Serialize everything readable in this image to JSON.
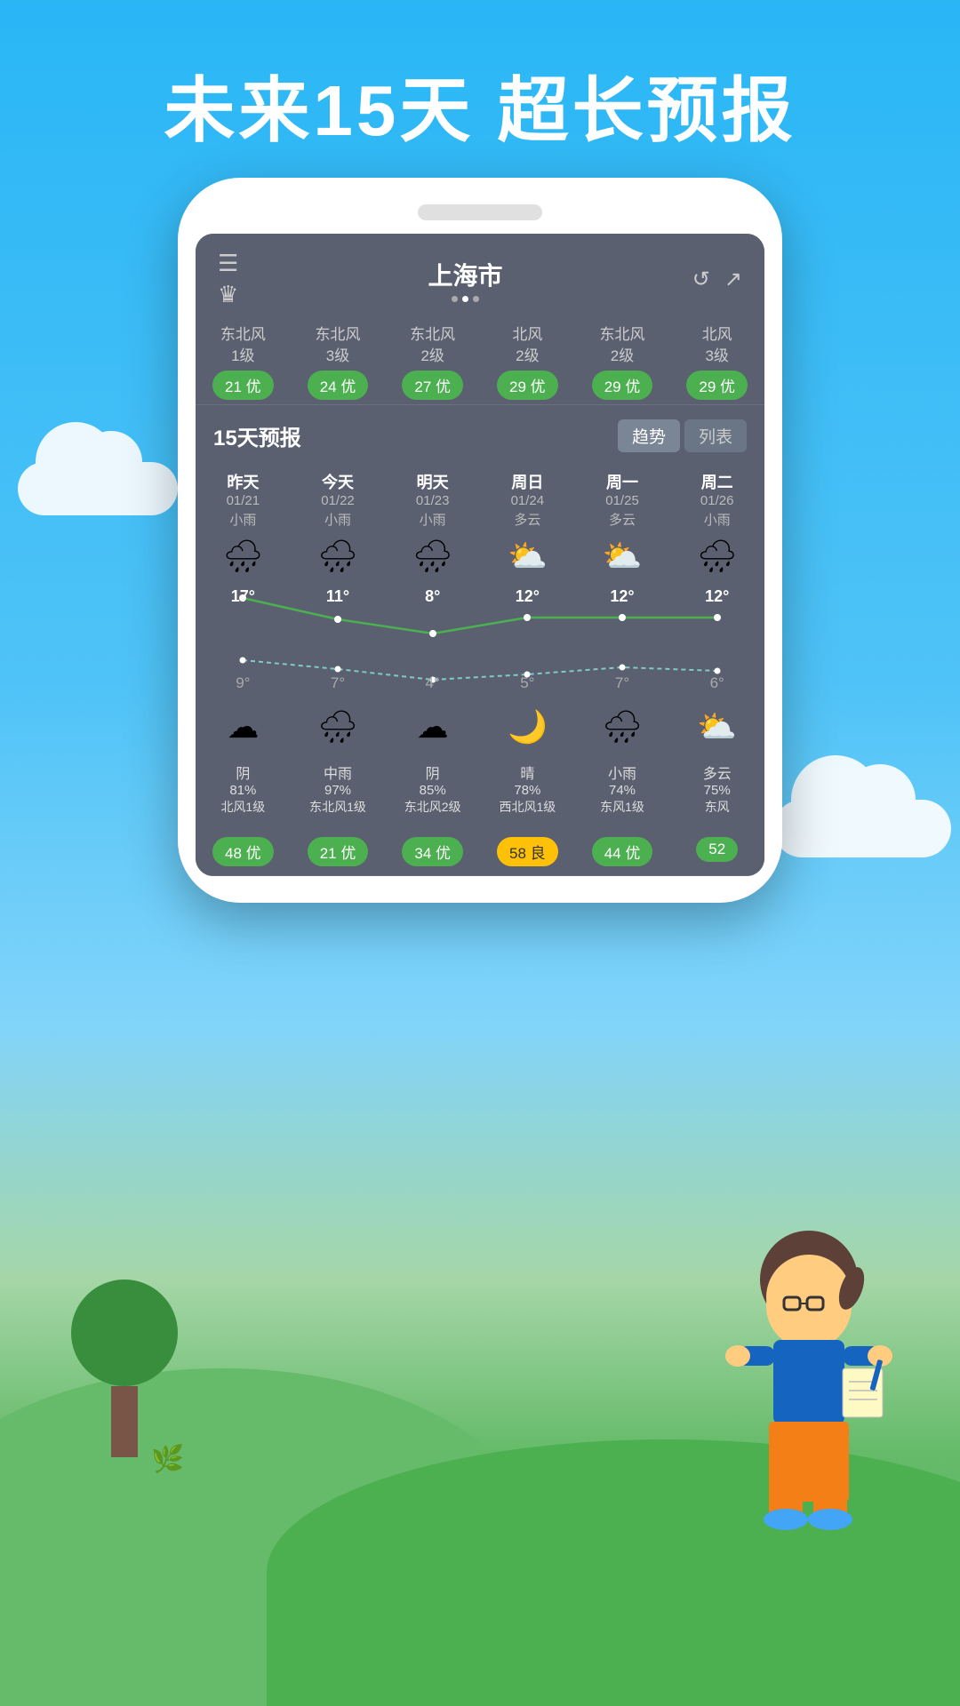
{
  "header": {
    "title": "未来15天  超长预报"
  },
  "app": {
    "city": "上海市",
    "menu_icon": "☰",
    "crown_icon": "♛",
    "refresh_icon": "↺",
    "share_icon": "↗",
    "dots": [
      false,
      true,
      false
    ]
  },
  "wind_row": [
    {
      "wind": "东北风\n1级",
      "aqi": "21 优",
      "type": "good"
    },
    {
      "wind": "东北风\n3级",
      "aqi": "24 优",
      "type": "good"
    },
    {
      "wind": "东北风\n2级",
      "aqi": "27 优",
      "type": "good"
    },
    {
      "wind": "北风\n2级",
      "aqi": "29 优",
      "type": "good"
    },
    {
      "wind": "东北风\n2级",
      "aqi": "29 优",
      "type": "good"
    },
    {
      "wind": "北风\n3级",
      "aqi": "29 优",
      "type": "good"
    }
  ],
  "forecast": {
    "title": "15天预报",
    "tab_trend": "趋势",
    "tab_list": "列表",
    "days": [
      {
        "name": "昨天",
        "date": "01/21",
        "weather": "小雨",
        "icon": "🌧",
        "high": "17°",
        "low": "9°"
      },
      {
        "name": "今天",
        "date": "01/22",
        "weather": "小雨",
        "icon": "🌧",
        "high": "11°",
        "low": "7°"
      },
      {
        "name": "明天",
        "date": "01/23",
        "weather": "小雨",
        "icon": "🌧",
        "high": "8°",
        "low": "4°"
      },
      {
        "name": "周日",
        "date": "01/24",
        "weather": "多云",
        "icon": "⛅",
        "high": "12°",
        "low": "5°"
      },
      {
        "name": "周一",
        "date": "01/25",
        "weather": "多云",
        "icon": "⛅",
        "high": "12°",
        "low": "7°"
      },
      {
        "name": "周二",
        "date": "01/26",
        "weather": "小雨",
        "icon": "🌧",
        "high": "12°",
        "low": "6°"
      }
    ]
  },
  "bottom_row": [
    {
      "icon": "☁",
      "weather": "阴",
      "humidity": "81%",
      "wind": "北风1级",
      "aqi": "48 优",
      "aqi_type": "good"
    },
    {
      "icon": "🌧",
      "weather": "中雨",
      "humidity": "97%",
      "wind": "东北风1级",
      "aqi": "21 优",
      "aqi_type": "good"
    },
    {
      "icon": "☁",
      "weather": "阴",
      "humidity": "85%",
      "wind": "东北风2级",
      "aqi": "34 优",
      "aqi_type": "good"
    },
    {
      "icon": "🌙",
      "weather": "晴",
      "humidity": "78%",
      "wind": "西北风1级",
      "aqi": "58 良",
      "aqi_type": "fair"
    },
    {
      "icon": "🌧",
      "weather": "小雨",
      "humidity": "74%",
      "wind": "东风1级",
      "aqi": "44 优",
      "aqi_type": "good"
    },
    {
      "icon": "⛅",
      "weather": "多云",
      "humidity": "75%",
      "wind": "东风",
      "aqi": "52",
      "aqi_type": "good"
    }
  ]
}
